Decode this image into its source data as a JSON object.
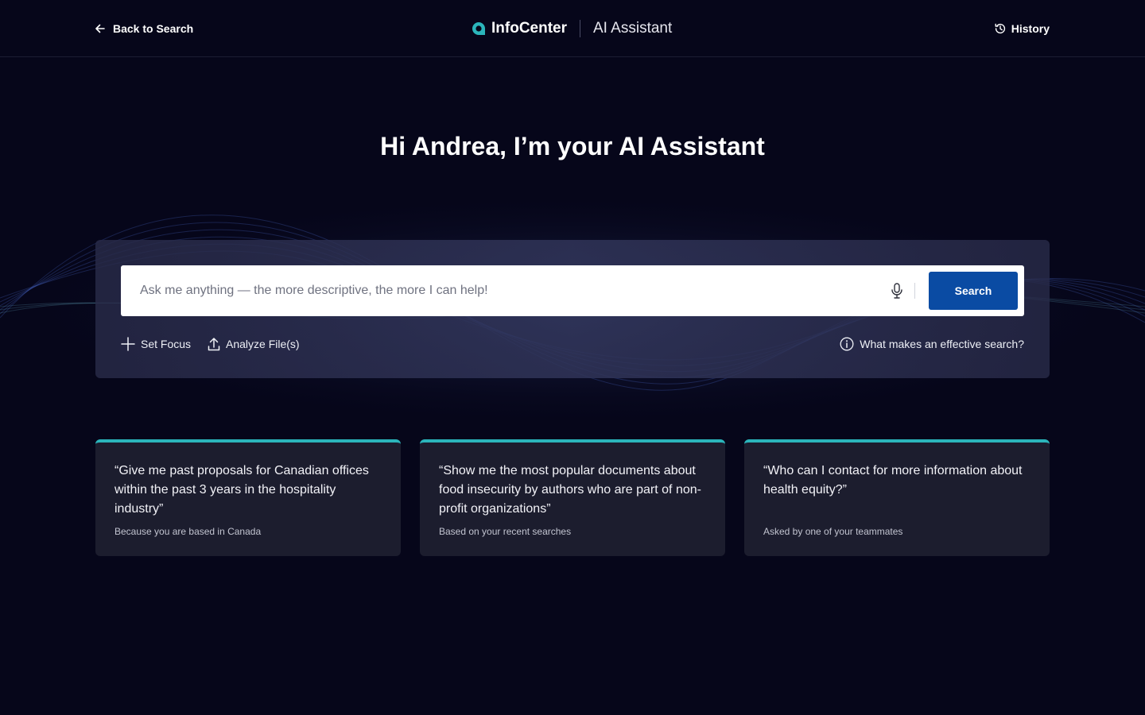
{
  "header": {
    "back_label": "Back to Search",
    "brand_name": "InfoCenter",
    "product_name": "AI Assistant",
    "history_label": "History"
  },
  "greeting": "Hi Andrea, I’m your AI Assistant",
  "search": {
    "placeholder": "Ask me anything — the more descriptive, the more I can help!",
    "value": "",
    "button_label": "Search"
  },
  "tools": {
    "set_focus": "Set Focus",
    "analyze_files": "Analyze File(s)",
    "help": "What makes an effective search?"
  },
  "suggestions": [
    {
      "quote": "“Give me past proposals for Canadian offices within the past 3 years in the hospitality industry”",
      "reason": "Because you are based in Canada"
    },
    {
      "quote": "“Show me the most popular documents about food insecurity by authors who are part of non-profit organizations”",
      "reason": "Based on your recent searches"
    },
    {
      "quote": "“Who can I contact for more information about health equity?”",
      "reason": "Asked by one of your teammates"
    }
  ],
  "colors": {
    "background": "#06061a",
    "accent": "#2bb5bb",
    "primary_button": "#0a4ba3"
  },
  "icons": [
    "arrow-left-icon",
    "chat-bubble-logo-icon",
    "history-icon",
    "microphone-icon",
    "plus-icon",
    "upload-icon",
    "info-icon"
  ]
}
